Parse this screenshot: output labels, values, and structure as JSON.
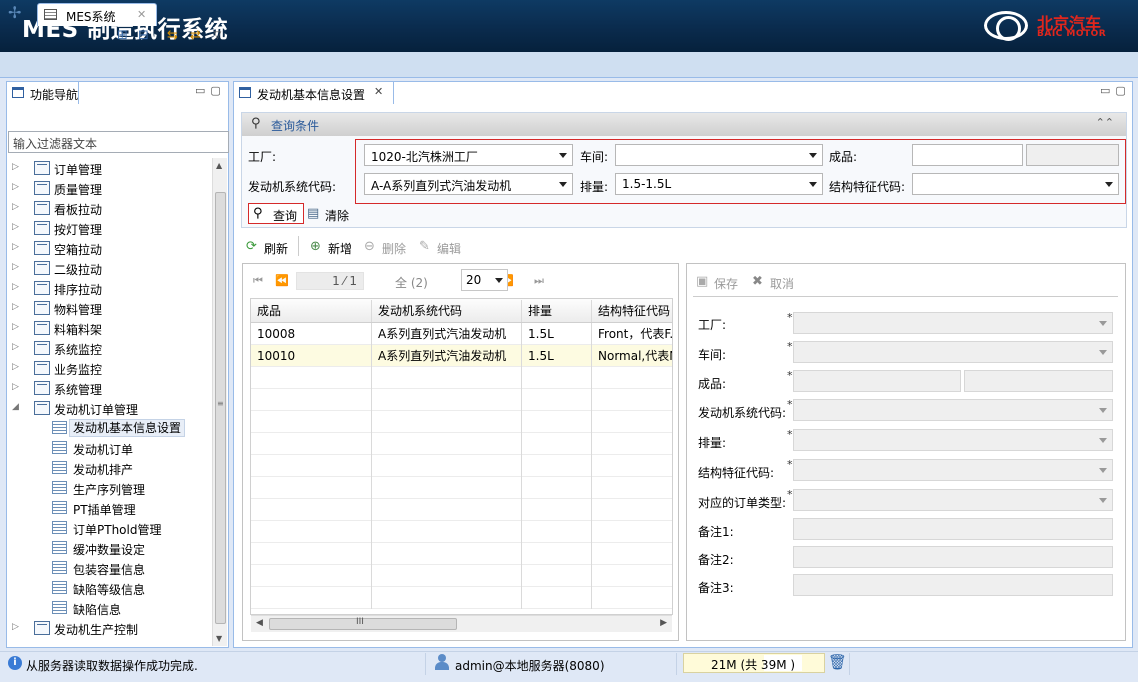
{
  "app": {
    "title": "MES 制造执行系统"
  },
  "brand": {
    "logo_cn": "北京汽车",
    "logo_en": "BAIC MOTOR",
    "accent": "#e1261c"
  },
  "tabs": [
    {
      "label": "MES系统"
    }
  ],
  "nav": {
    "title": "功能导航",
    "filter_placeholder": "输入过滤器文本",
    "items": [
      {
        "label": "订单管理",
        "expanded": false
      },
      {
        "label": "质量管理",
        "expanded": false
      },
      {
        "label": "看板拉动",
        "expanded": false
      },
      {
        "label": "按灯管理",
        "expanded": false
      },
      {
        "label": "空箱拉动",
        "expanded": false
      },
      {
        "label": "二级拉动",
        "expanded": false
      },
      {
        "label": "排序拉动",
        "expanded": false
      },
      {
        "label": "物料管理",
        "expanded": false
      },
      {
        "label": "料箱料架",
        "expanded": false
      },
      {
        "label": "系统监控",
        "expanded": false
      },
      {
        "label": "业务监控",
        "expanded": false
      },
      {
        "label": "系统管理",
        "expanded": false
      },
      {
        "label": "发动机订单管理",
        "expanded": true
      },
      {
        "label": "发动机基本信息设置",
        "child": true,
        "selected": true
      },
      {
        "label": "发动机订单",
        "child": true
      },
      {
        "label": "发动机排产",
        "child": true
      },
      {
        "label": "生产序列管理",
        "child": true
      },
      {
        "label": "PT插单管理",
        "child": true
      },
      {
        "label": "订单PThold管理",
        "child": true
      },
      {
        "label": "缓冲数量设定",
        "child": true
      },
      {
        "label": "包装容量信息",
        "child": true
      },
      {
        "label": "缺陷等级信息",
        "child": true
      },
      {
        "label": "缺陷信息",
        "child": true
      },
      {
        "label": "发动机生产控制",
        "expanded": false
      }
    ]
  },
  "main": {
    "tab_label": "发动机基本信息设置",
    "query": {
      "title": "查询条件",
      "factory_label": "工厂:",
      "factory_value": "1020-北汽株洲工厂",
      "workshop_label": "车间:",
      "workshop_value": "",
      "product_label": "成品:",
      "product_value": "",
      "engine_code_label": "发动机系统代码:",
      "engine_code_value": "A-A系列直列式汽油发动机",
      "displacement_label": "排量:",
      "displacement_value": "1.5-1.5L",
      "struct_label": "结构特征代码:",
      "struct_value": "",
      "search_btn": "查询",
      "clear_btn": "清除"
    },
    "toolbar": {
      "refresh": "刷新",
      "add": "新增",
      "delete": "删除",
      "edit": "编辑"
    },
    "pager": {
      "page_text": "1 ⁄ 1",
      "all_text": "全 (2)",
      "page_size": "20"
    },
    "table": {
      "columns": [
        "成品",
        "发动机系统代码",
        "排量",
        "结构特征代码"
      ],
      "rows": [
        [
          "10008",
          "A系列直列式汽油发动机",
          "1.5L",
          "Front，代表F..."
        ],
        [
          "10010",
          "A系列直列式汽油发动机",
          "1.5L",
          "Normal,代表N..."
        ]
      ]
    },
    "form": {
      "save": "保存",
      "cancel": "取消",
      "fields": [
        {
          "label": "工厂:",
          "required": true,
          "type": "combo"
        },
        {
          "label": "车间:",
          "required": true,
          "type": "combo"
        },
        {
          "label": "成品:",
          "required": true,
          "type": "pair"
        },
        {
          "label": "发动机系统代码:",
          "required": true,
          "type": "combo"
        },
        {
          "label": "排量:",
          "required": true,
          "type": "combo"
        },
        {
          "label": "结构特征代码:",
          "required": true,
          "type": "combo"
        },
        {
          "label": "对应的订单类型:",
          "required": true,
          "type": "combo"
        },
        {
          "label": "备注1:",
          "required": false,
          "type": "text"
        },
        {
          "label": "备注2:",
          "required": false,
          "type": "text"
        },
        {
          "label": "备注3:",
          "required": false,
          "type": "text"
        }
      ]
    }
  },
  "status": {
    "message": "从服务器读取数据操作成功完成.",
    "user": "admin@本地服务器(8080)",
    "memory": "21M (共 39M )"
  }
}
